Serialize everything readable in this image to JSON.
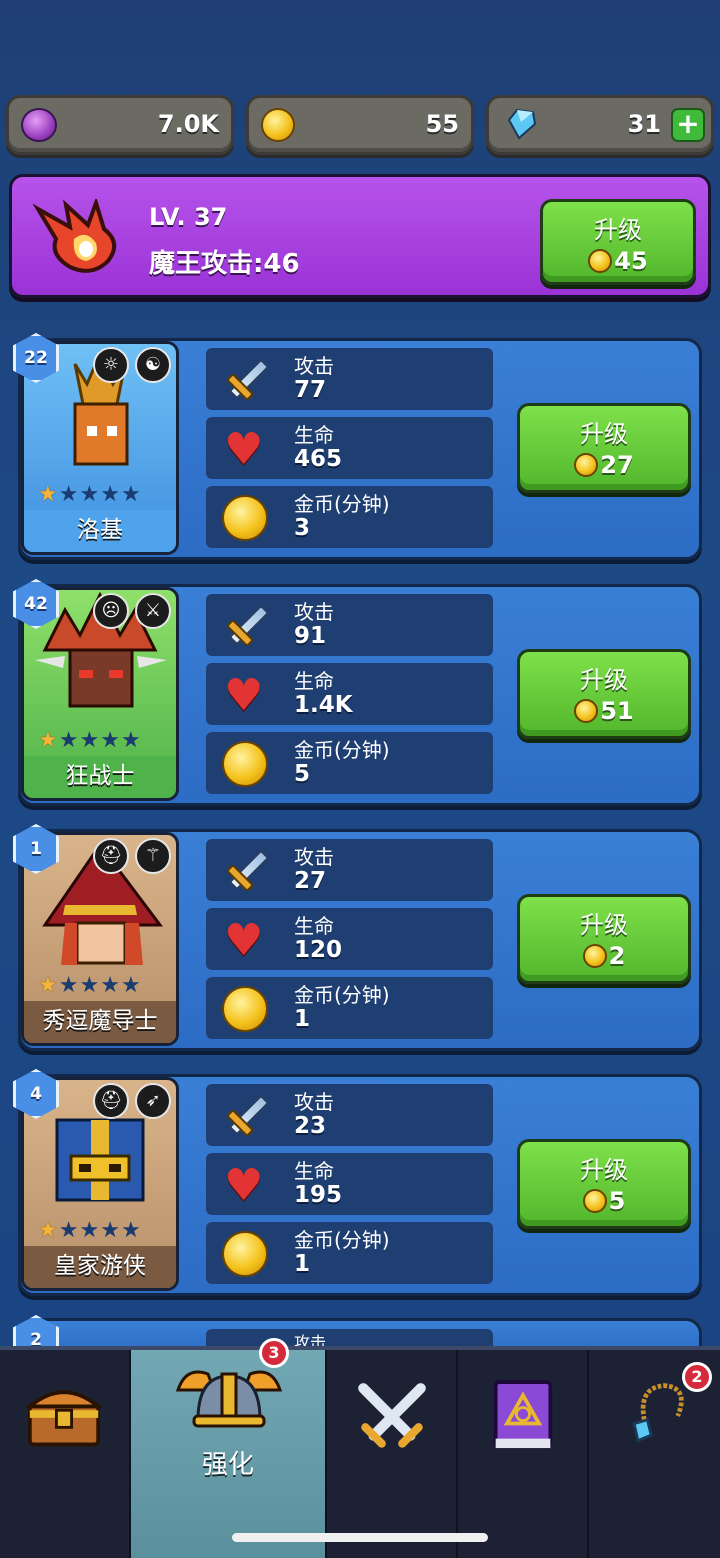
{
  "resources": {
    "elixir": "7.0K",
    "gold": "55",
    "gems": "31"
  },
  "boss": {
    "level": "LV. 37",
    "attack": "魔王攻击:46",
    "upgrade_label": "升级",
    "upgrade_cost": "45"
  },
  "stat_labels": {
    "attack": "攻击",
    "health": "生命",
    "gold": "金币(分钟)"
  },
  "heroes": [
    {
      "name": "洛基",
      "level": "22",
      "stars": 1,
      "attack": "77",
      "health": "465",
      "gold": "3",
      "upgrade_label": "升级",
      "upgrade_cost": "27",
      "card_color": "#4fa2ec"
    },
    {
      "name": "狂战士",
      "level": "42",
      "stars": 1,
      "attack": "91",
      "health": "1.4K",
      "gold": "5",
      "upgrade_label": "升级",
      "upgrade_cost": "51",
      "card_color": "#4fb24a"
    },
    {
      "name": "秀逗魔导士",
      "level": "1",
      "stars": 1,
      "attack": "27",
      "health": "120",
      "gold": "1",
      "upgrade_label": "升级",
      "upgrade_cost": "2",
      "card_color": "#7a5a40"
    },
    {
      "name": "皇家游侠",
      "level": "4",
      "stars": 1,
      "attack": "23",
      "health": "195",
      "gold": "1",
      "upgrade_label": "升级",
      "upgrade_cost": "5",
      "card_color": "#7a5a40"
    }
  ],
  "peek_hero": {
    "level": "2",
    "attack_label": "攻击"
  },
  "nav": {
    "upgrade_tab_label": "强化",
    "upgrade_tab_badge": "3",
    "amulet_badge": "2"
  }
}
